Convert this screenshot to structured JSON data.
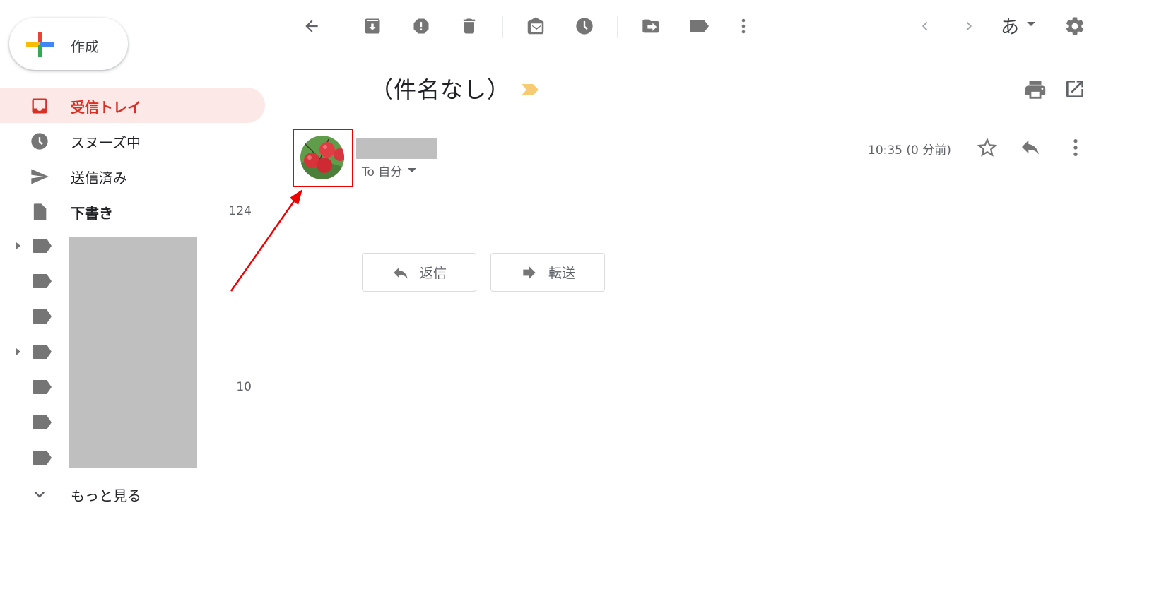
{
  "sidebar": {
    "compose_label": "作成",
    "nav": [
      {
        "label": "受信トレイ",
        "icon": "inbox-icon",
        "active": true,
        "count": ""
      },
      {
        "label": "スヌーズ中",
        "icon": "clock-icon",
        "active": false,
        "count": ""
      },
      {
        "label": "送信済み",
        "icon": "send-icon",
        "active": false,
        "count": ""
      },
      {
        "label": "下書き",
        "icon": "draft-icon",
        "active": false,
        "count": "124"
      }
    ],
    "labels": [
      {
        "has_children": true,
        "count": ""
      },
      {
        "has_children": false,
        "count": ""
      },
      {
        "has_children": false,
        "count": ""
      },
      {
        "has_children": true,
        "count": ""
      },
      {
        "has_children": false,
        "count": "10"
      },
      {
        "has_children": false,
        "count": ""
      },
      {
        "has_children": false,
        "count": ""
      }
    ],
    "more_label": "もっと見る"
  },
  "toolbar": {
    "buttons": [
      "back-icon",
      "archive-icon",
      "report-spam-icon",
      "delete-icon",
      "mark-unread-icon",
      "snooze-icon",
      "move-to-icon",
      "label-icon",
      "more-vert-icon"
    ],
    "lang_label": "あ"
  },
  "message": {
    "subject": "（件名なし）",
    "to_label": "To 自分",
    "timestamp": "10:35 (0 分前)",
    "reply_label": "返信",
    "forward_label": "転送"
  },
  "colors": {
    "accent_red": "#d93025",
    "active_bg": "#fce8e6",
    "icon_gray": "#757575",
    "importance_yellow": "#f7cb73",
    "annotation_red": "#ee0000",
    "redaction_gray": "#bfbfbf"
  }
}
